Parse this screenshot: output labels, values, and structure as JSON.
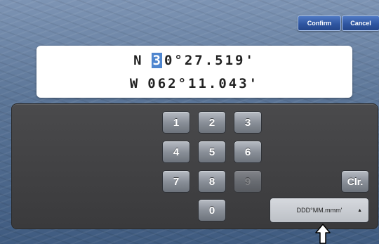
{
  "toolbar": {
    "confirm_label": "Confirm",
    "cancel_label": "Cancel"
  },
  "coordinates": {
    "latitude": {
      "hemisphere": "N",
      "cursor_digit": "3",
      "rest": "0°27.519'"
    },
    "longitude": {
      "hemisphere": "W",
      "value": "062°11.043'"
    }
  },
  "keypad": {
    "keys": [
      "1",
      "2",
      "3",
      "4",
      "5",
      "6",
      "7",
      "8",
      "9",
      "0"
    ],
    "disabled_keys": [
      "9"
    ],
    "clear_label": "Clr."
  },
  "format_dropdown": {
    "selected": "DDD°MM.mmm'",
    "caret": "▲"
  },
  "icons": {
    "pointer": "up-arrow-pointer-icon"
  }
}
